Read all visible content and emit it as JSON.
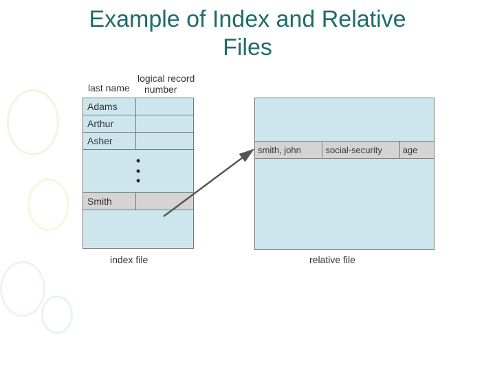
{
  "title_line1": "Example of Index and Relative",
  "title_line2": "Files",
  "headers": {
    "last_name": "last name",
    "logical_record": "logical record",
    "number": "number"
  },
  "index_rows": [
    "Adams",
    "Arthur",
    "Asher"
  ],
  "smith_label": "Smith",
  "captions": {
    "index": "index file",
    "relative": "relative file"
  },
  "relative_row": {
    "name": "smith, john",
    "ssn": "social-security",
    "age": "age"
  }
}
